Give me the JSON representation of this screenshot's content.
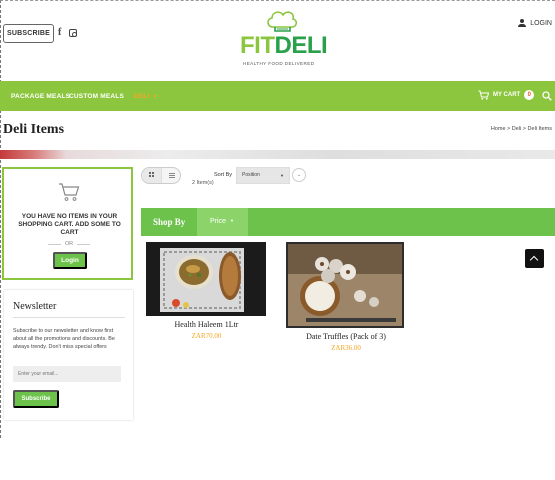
{
  "header": {
    "subscribe_label": "SUBSCRIBE",
    "social_icons": [
      "facebook-icon",
      "instagram-icon"
    ],
    "login_label": "LOGIN",
    "logo": {
      "part1": "FIT",
      "part2": "DELI",
      "tagline": "HEALTHY FOOD DELIVERED",
      "colors": {
        "fit": "#8cc63f",
        "deli": "#2aa04a"
      }
    }
  },
  "nav": {
    "items": [
      {
        "label": "PACKAGE MEALS",
        "active": false
      },
      {
        "label": "CUSTOM MEALS",
        "active": false
      },
      {
        "label": "DELI",
        "active": true
      }
    ],
    "cart_label": "MY CART",
    "cart_count": "0",
    "background": "#8cc63f",
    "active_color": "#f5a623"
  },
  "page": {
    "title": "Deli Items",
    "breadcrumb": [
      "Home",
      "Deli",
      "Deli Items"
    ],
    "breadcrumb_sep": ">"
  },
  "mini_cart": {
    "empty_message": "YOU HAVE NO ITEMS IN YOUR SHOPPING CART. ADD SOME TO CART",
    "or_label": "OR",
    "login_label": "Login"
  },
  "newsletter": {
    "title": "Newsletter",
    "text": "Subscribe to our newsletter and know first about all the promotions and discounts. Be always trendy. Don't miss special offers",
    "placeholder": "Enter your email...",
    "button_label": "Subscribe"
  },
  "toolbar": {
    "item_count": "2 Item(s)",
    "sort_label": "Sort By",
    "sort_value": "Position",
    "sort_dir_icon": "chevron-down-icon"
  },
  "shop_by": {
    "label": "Shop By",
    "filters": [
      {
        "label": "Price"
      }
    ]
  },
  "products": [
    {
      "name": "Health Haleem 1Ltr",
      "price": "ZAR70.00"
    },
    {
      "name": "Date Truffles (Pack of 3)",
      "price": "ZAR36.00"
    }
  ],
  "colors": {
    "accent_green": "#6cc24a",
    "price_orange": "#f5a623"
  }
}
